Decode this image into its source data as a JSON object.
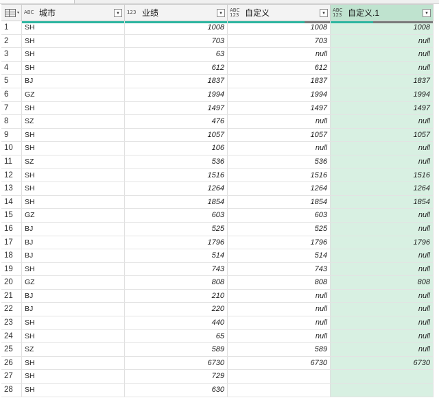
{
  "columns": [
    {
      "name": "城市",
      "type_top": "A",
      "type_mid": "B",
      "type_bot": "C"
    },
    {
      "name": "业绩",
      "type_top": "1",
      "type_mid": "2",
      "type_bot": "3"
    },
    {
      "name": "自定义",
      "type_top": "ABC",
      "type_mid": "",
      "type_bot": "123"
    },
    {
      "name": "自定义.1",
      "type_top": "ABC",
      "type_mid": "",
      "type_bot": "123"
    }
  ],
  "colors": {
    "quality_valid": "#2bb5a0",
    "quality_error": "#7a7a7a",
    "selected_col": "#d8f0e2"
  },
  "rows": [
    [
      "1",
      "SH",
      "1008",
      "1008",
      "1008"
    ],
    [
      "2",
      "SH",
      "703",
      "703",
      "null"
    ],
    [
      "3",
      "SH",
      "63",
      "null",
      "null"
    ],
    [
      "4",
      "SH",
      "612",
      "612",
      "null"
    ],
    [
      "5",
      "BJ",
      "1837",
      "1837",
      "1837"
    ],
    [
      "6",
      "GZ",
      "1994",
      "1994",
      "1994"
    ],
    [
      "7",
      "SH",
      "1497",
      "1497",
      "1497"
    ],
    [
      "8",
      "SZ",
      "476",
      "null",
      "null"
    ],
    [
      "9",
      "SH",
      "1057",
      "1057",
      "1057"
    ],
    [
      "10",
      "SH",
      "106",
      "null",
      "null"
    ],
    [
      "11",
      "SZ",
      "536",
      "536",
      "null"
    ],
    [
      "12",
      "SH",
      "1516",
      "1516",
      "1516"
    ],
    [
      "13",
      "SH",
      "1264",
      "1264",
      "1264"
    ],
    [
      "14",
      "SH",
      "1854",
      "1854",
      "1854"
    ],
    [
      "15",
      "GZ",
      "603",
      "603",
      "null"
    ],
    [
      "16",
      "BJ",
      "525",
      "525",
      "null"
    ],
    [
      "17",
      "BJ",
      "1796",
      "1796",
      "1796"
    ],
    [
      "18",
      "BJ",
      "514",
      "514",
      "null"
    ],
    [
      "19",
      "SH",
      "743",
      "743",
      "null"
    ],
    [
      "20",
      "GZ",
      "808",
      "808",
      "808"
    ],
    [
      "21",
      "BJ",
      "210",
      "null",
      "null"
    ],
    [
      "22",
      "BJ",
      "220",
      "null",
      "null"
    ],
    [
      "23",
      "SH",
      "440",
      "null",
      "null"
    ],
    [
      "24",
      "SH",
      "65",
      "null",
      "null"
    ],
    [
      "25",
      "SZ",
      "589",
      "589",
      "null"
    ],
    [
      "26",
      "SH",
      "6730",
      "6730",
      "6730"
    ],
    [
      "27",
      "SH",
      "729",
      "",
      ""
    ],
    [
      "28",
      "SH",
      "630",
      "",
      ""
    ]
  ]
}
